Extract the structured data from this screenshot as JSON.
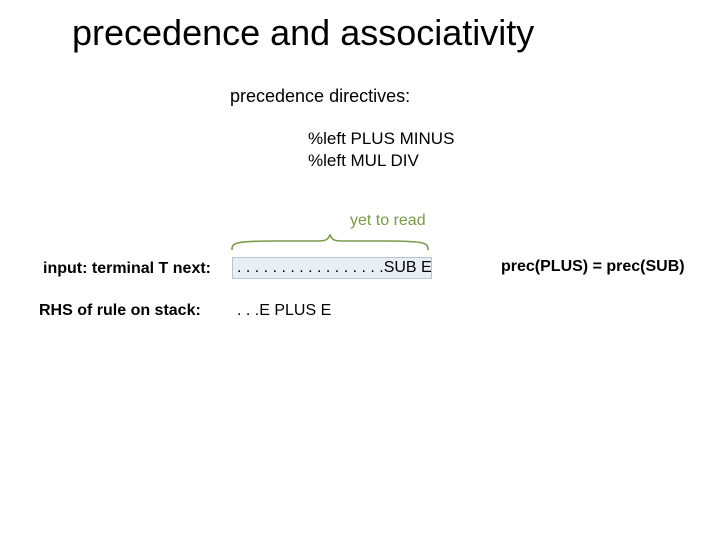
{
  "title": "precedence and associativity",
  "subtitle": "precedence directives:",
  "directives": "%left PLUS MINUS\n%left MUL DIV",
  "yet_to_read": "yet to read",
  "input_label": "input: terminal T next:",
  "dots_sub": ". . . . . . . . . . . . . . . . .SUB E",
  "rhs_label": "RHS of rule on stack:",
  "rhs_value": ". . .E PLUS E",
  "prec_eq": "prec(PLUS) = prec(SUB)"
}
